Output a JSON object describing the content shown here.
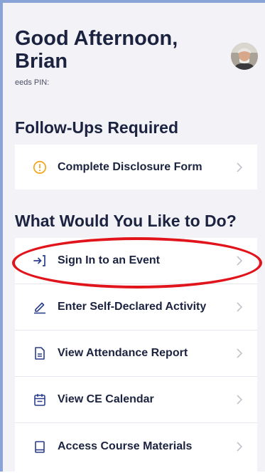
{
  "greeting": {
    "line1": "Good Afternoon,",
    "line2": "Brian",
    "pin_label": "eeds PIN:"
  },
  "avatar": {
    "icon": "user-photo-avatar"
  },
  "followups": {
    "title": "Follow-Ups Required",
    "items": [
      {
        "label": "Complete Disclosure Form",
        "icon": "alert-circle-icon",
        "color": "#f5a623"
      }
    ]
  },
  "actions": {
    "title": "What Would You Like to Do?",
    "items": [
      {
        "label": "Sign In to an Event",
        "icon": "sign-in-icon"
      },
      {
        "label": "Enter Self-Declared Activity",
        "icon": "pencil-icon"
      },
      {
        "label": "View Attendance Report",
        "icon": "document-icon"
      },
      {
        "label": "View CE Calendar",
        "icon": "calendar-icon"
      },
      {
        "label": "Access Course Materials",
        "icon": "book-icon"
      }
    ]
  },
  "colors": {
    "accent": "#2c3e8c",
    "highlight": "#e0141a",
    "warning": "#f5a623"
  }
}
